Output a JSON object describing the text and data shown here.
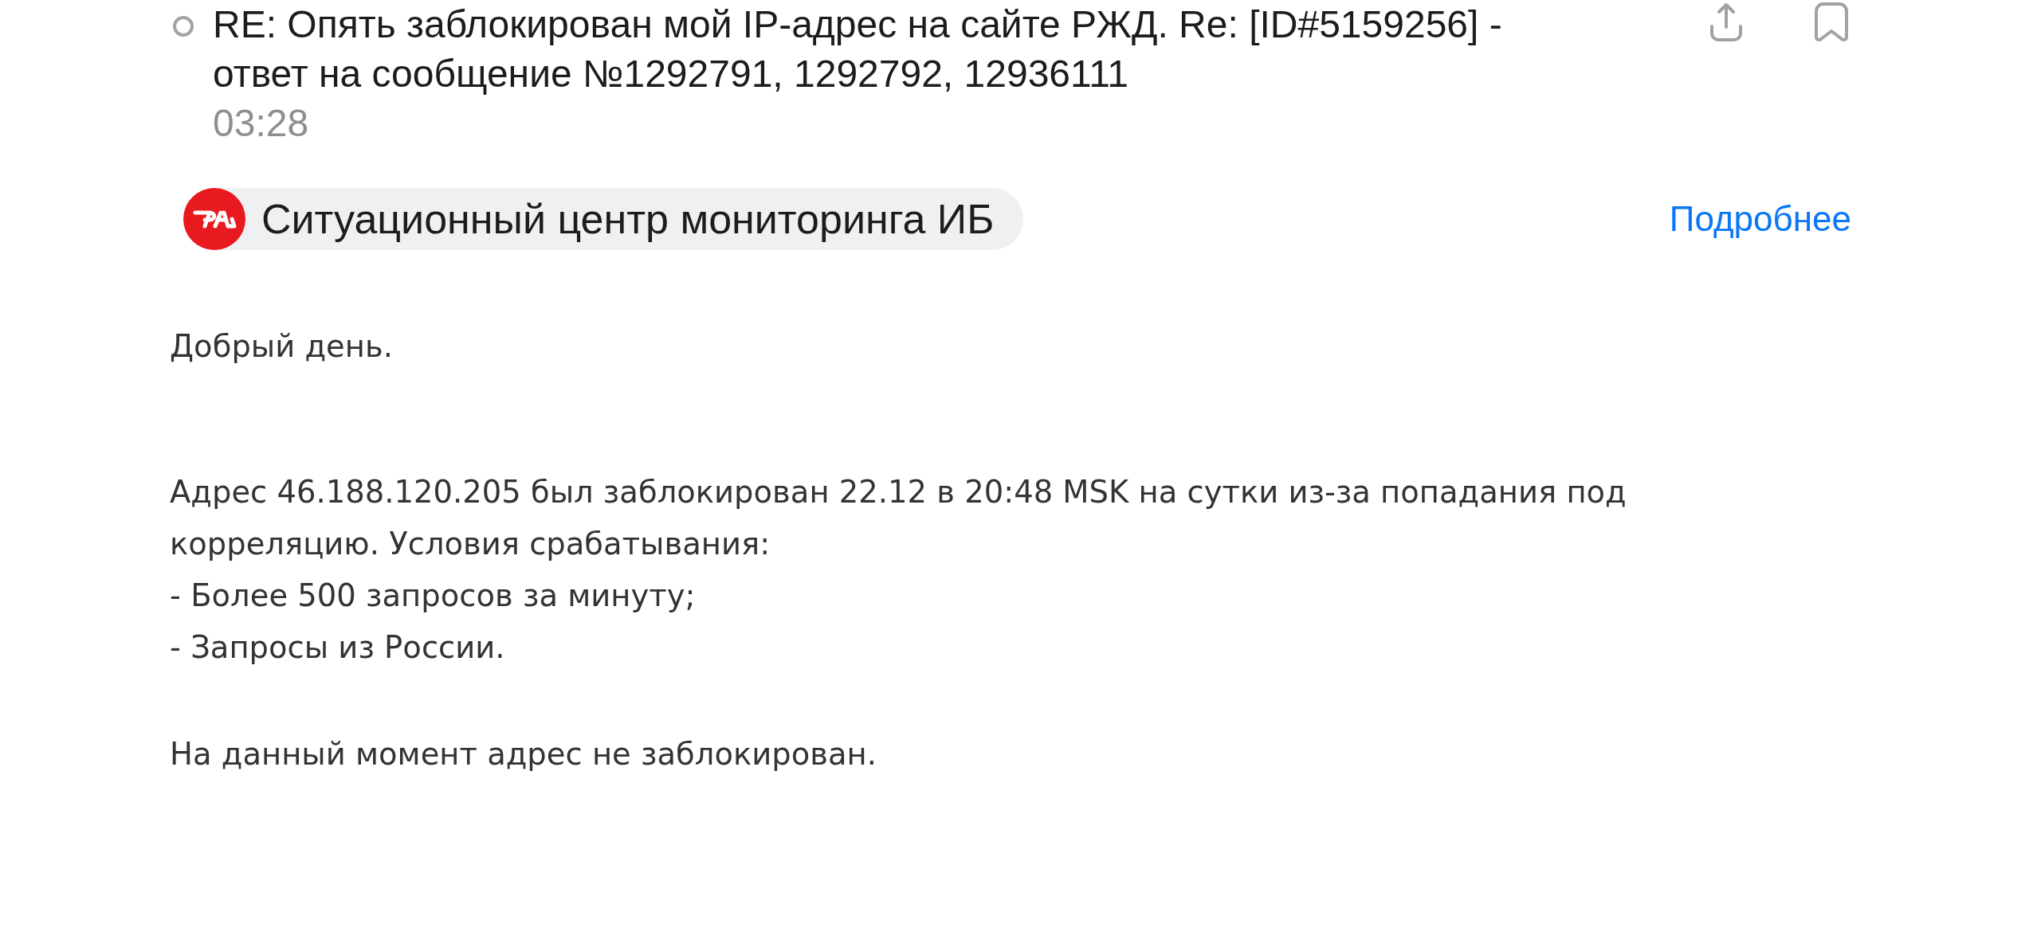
{
  "header": {
    "unread": false,
    "subject": "RE: Опять заблокирован мой IP-адрес на сайте РЖД. Re: [ID#5159256] - ответ на сообщение №1292791, 1292792, 12936111",
    "time": "03:28"
  },
  "sender": {
    "name": "Ситуационный центр мониторинга ИБ",
    "details_link": "Подробнее"
  },
  "body": {
    "paragraphs": [
      {
        "kind": "greeting",
        "lines": [
          "Добрый день."
        ]
      },
      {
        "kind": "text",
        "lines": [
          "Адрес 46.188.120.205 был заблокирован 22.12 в 20:48 MSK на сутки из-за попадания под корреляцию. Условия срабатывания:",
          "- Более 500 запросов за минуту;",
          "- Запросы из России."
        ]
      },
      {
        "kind": "text",
        "lines": [
          "На данный момент адрес не заблокирован."
        ]
      }
    ]
  }
}
